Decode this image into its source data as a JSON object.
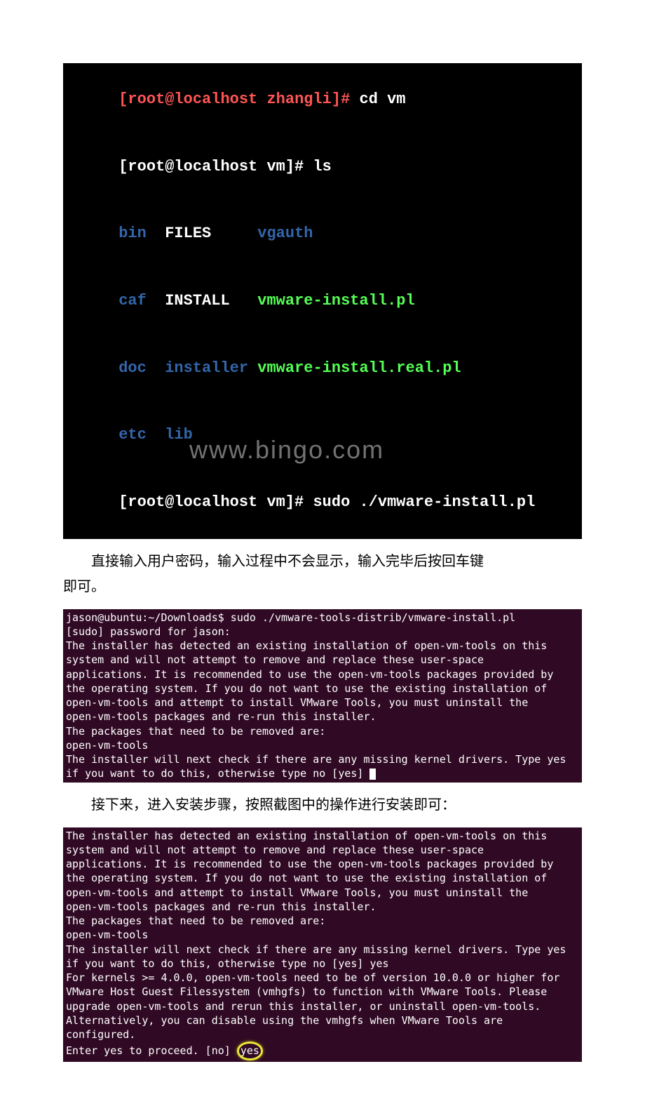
{
  "terminal1": {
    "l1_prompt_host": "[root@localhost",
    "l1_prompt_dir": " zhangli]#",
    "l1_cmd": " cd vm",
    "l2_prompt": "[root@localhost vm]# ",
    "l2_cmd": "ls",
    "l3_c1": "bin",
    "l3_c2": "  FILES     ",
    "l3_c3": "vgauth",
    "l4_c1": "caf",
    "l4_c2": "  INSTALL   ",
    "l4_c3": "vmware-install.pl",
    "l5_c1": "doc",
    "l5_c2": "  installer",
    "l5_c3": " vmware-install.real.pl",
    "l6_c1": "etc",
    "l6_c2": "  lib",
    "l7_prompt": "[root@localhost vm]# ",
    "l7_cmd": "sudo ./vmware-install.pl"
  },
  "para1a": "直接输入用户密码，输入过程中不会显示，输入完毕后按回车键",
  "para1b": "即可。",
  "terminal2": {
    "prompt_user": "jason@ubuntu",
    "prompt_path": ":~/Downloads$",
    "cmd": " sudo ./vmware-tools-distrib/vmware-install.pl",
    "sudo_line": "[sudo] password for jason:",
    "body": "The installer has detected an existing installation of open-vm-tools on this\nsystem and will not attempt to remove and replace these user-space\napplications. It is recommended to use the open-vm-tools packages provided by\nthe operating system. If you do not want to use the existing installation of\nopen-vm-tools and attempt to install VMware Tools, you must uninstall the\nopen-vm-tools packages and re-run this installer.\nThe packages that need to be removed are:\nopen-vm-tools\nThe installer will next check if there are any missing kernel drivers. Type yes\nif you want to do this, otherwise type no [yes] "
  },
  "para2": "接下来，进入安装步骤，按照截图中的操作进行安装即可：",
  "terminal3": {
    "body1": "The installer has detected an existing installation of open-vm-tools on this\nsystem and will not attempt to remove and replace these user-space\napplications. It is recommended to use the open-vm-tools packages provided by\nthe operating system. If you do not want to use the existing installation of\nopen-vm-tools and attempt to install VMware Tools, you must uninstall the\nopen-vm-tools packages and re-run this installer.\nThe packages that need to be removed are:\nopen-vm-tools\nThe installer will next check if there are any missing kernel drivers. Type yes\nif you want to do this, otherwise type no [yes] yes\n",
    "body2": "For kernels >= 4.0.0, open-vm-tools need to be of version 10.0.0 or higher for\nVMware Host Guest Filessystem (vmhgfs) to function with VMware Tools. Please\nupgrade open-vm-tools and rerun this installer, or uninstall open-vm-tools.\nAlternatively, you can disable using the vmhgfs when VMware Tools are\nconfigured.\n",
    "prompt_line_pre": "Enter yes to proceed. [no] ",
    "prompt_answer": "yes"
  },
  "watermark": "www.bingo.com"
}
